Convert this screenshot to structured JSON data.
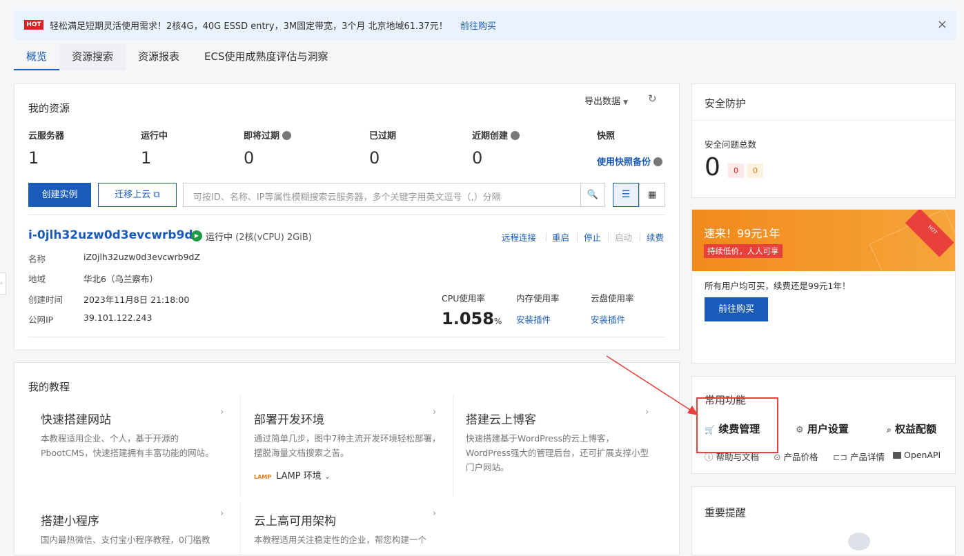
{
  "banner": {
    "badge": "HOT",
    "text": "轻松满足短期灵活使用需求！2核4G，40G ESSD entry，3M固定带宽，3个月 北京地域61.37元！",
    "link": "前往购买",
    "close": "×"
  },
  "tabs": [
    "概览",
    "资源搜索",
    "资源报表",
    "ECS使用成熟度评估与洞察"
  ],
  "resources": {
    "title": "我的资源",
    "export": "导出数据",
    "stats": [
      {
        "label": "云服务器",
        "value": "1"
      },
      {
        "label": "运行中",
        "value": "1"
      },
      {
        "label": "即将过期",
        "value": "0"
      },
      {
        "label": "已过期",
        "value": "0"
      },
      {
        "label": "近期创建",
        "value": "0"
      },
      {
        "label": "快照",
        "value": "使用快照备份"
      }
    ],
    "create_button": "创建实例",
    "migrate_button": "迁移上云",
    "search_placeholder": "可按ID、名称、IP等属性模糊搜索云服务器，多个关键字用英文逗号（,）分隔"
  },
  "instance": {
    "id": "i-0jlh32uzw0d3evcwrb9d",
    "status": "运行中",
    "spec": "(2核(vCPU) 2GiB)",
    "actions": [
      "远程连接",
      "重启",
      "停止",
      "启动",
      "续费"
    ],
    "fields": [
      {
        "key": "名称",
        "value": "iZ0jlh32uzw0d3evcwrb9dZ"
      },
      {
        "key": "地域",
        "value": "华北6（乌兰察布）"
      },
      {
        "key": "创建时间",
        "value": "2023年11月8日 21:18:00"
      },
      {
        "key": "公网IP",
        "value": "39.101.122.243"
      }
    ],
    "cpu_label": "CPU使用率",
    "cpu_value": "1.058",
    "cpu_unit": "%",
    "mem_label": "内存使用率",
    "mem_action": "安装插件",
    "disk_label": "云盘使用率",
    "disk_action": "安装插件"
  },
  "tutorials": {
    "title": "我的教程",
    "items": [
      {
        "title": "快速搭建网站",
        "desc": "本教程适用企业、个人，基于开源的PbootCMS，快速搭建拥有丰富功能的网站。"
      },
      {
        "title": "部署开发环境",
        "desc": "通过简单几步，图中7种主流开发环境轻松部署，摆脱海量文档搜索之苦。",
        "env": "LAMP 环境"
      },
      {
        "title": "搭建云上博客",
        "desc": "快速搭建基于WordPress的云上博客，WordPress强大的管理后台，还可扩展支撑小型门户网站。"
      },
      {
        "title": "搭建小程序",
        "desc": "国内最热微信、支付宝小程序教程，0门槛教"
      },
      {
        "title": "云上高可用架构",
        "desc": "本教程适用关注稳定性的企业，帮您构建一个"
      }
    ],
    "lamp_logo": "LAMP"
  },
  "security": {
    "title": "安全防护",
    "label": "安全问题总数",
    "total": "0",
    "badge1": "0",
    "badge2": "0"
  },
  "promo": {
    "title": "速来！99元1年",
    "tag": "持续低价，人人可享",
    "corner": "HOT",
    "desc": "所有用户均可买，续费还是99元1年！",
    "button": "前往购买",
    "accent": "#f7a11a"
  },
  "common": {
    "title": "常用功能",
    "main": [
      "续费管理",
      "用户设置",
      "权益配额"
    ],
    "sub": [
      "帮助与文档",
      "产品价格",
      "产品详情",
      "OpenAPI"
    ]
  },
  "reminder": {
    "title": "重要提醒"
  },
  "colors": {
    "brand": "#1a5bb8",
    "highlight": "#e8403a"
  }
}
